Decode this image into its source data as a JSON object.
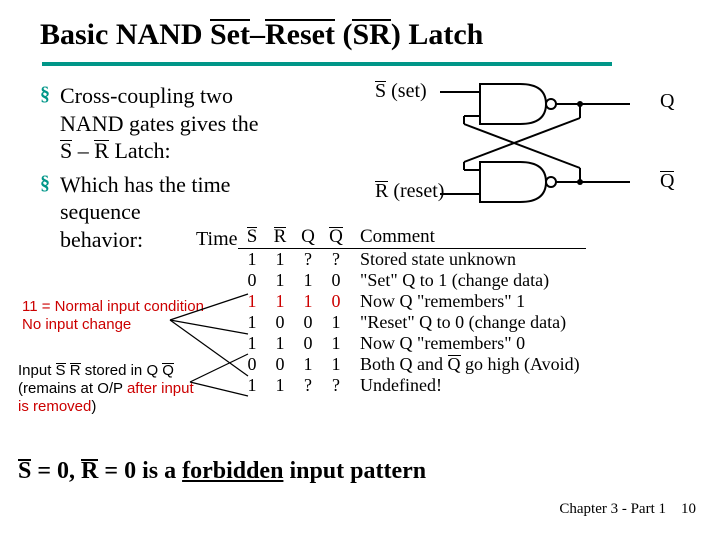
{
  "title": {
    "t1": "Basic NAND ",
    "set": "Set",
    "dash": "–",
    "reset": "Reset",
    "paren1": " (",
    "S": "S",
    "R": "R",
    "paren2": ") Latch"
  },
  "bullets": {
    "b1a": "Cross-coupling two",
    "b1b": "NAND gates gives the",
    "b1c_S": "S",
    "b1c_mid": " – ",
    "b1c_R": "R",
    "b1c_end": " Latch:",
    "b2a": "Which has the time",
    "b2b": "sequence",
    "b2c": "behavior:"
  },
  "time_label": "Time",
  "diagram": {
    "s": "S",
    "s_paren": " (set)",
    "r": "R",
    "r_paren": " (reset)",
    "Q": "Q",
    "Qb": "Q"
  },
  "note1": {
    "l1": "11 = Normal input condition",
    "l2": "No input change"
  },
  "note2": {
    "l1a": "Input ",
    "S": "S",
    "sp": " ",
    "R": "R",
    "l1b": " stored in ",
    "Q": "Q",
    "Qb": "Q",
    "l2": "(remains at O/P ",
    "l2r": "after input",
    "l3": "is removed",
    "l3b": ")"
  },
  "headers": {
    "S": "S",
    "R": "R",
    "Q": "Q",
    "Qb": "Q",
    "C": "Comment"
  },
  "rows": [
    {
      "s": "1",
      "r": "1",
      "q": "?",
      "qb": "?",
      "c": "Stored state unknown"
    },
    {
      "s": "0",
      "r": "1",
      "q": "1",
      "qb": "0",
      "c": "\"Set\" Q to 1 (change data)"
    },
    {
      "s": "1",
      "r": "1",
      "q": "1",
      "qb": "0",
      "c": "Now Q \"remembers\" 1",
      "red": true
    },
    {
      "s": "1",
      "r": "0",
      "q": "0",
      "qb": "1",
      "c": "\"Reset\" Q to 0 (change data)"
    },
    {
      "s": "1",
      "r": "1",
      "q": "0",
      "qb": "1",
      "c": "Now Q \"remembers\" 0"
    },
    {
      "s": "0",
      "r": "0",
      "q": "1",
      "qb": "1",
      "c_pre": "Both Q and ",
      "c_qb": "Q",
      "c_post": " go high (Avoid)"
    },
    {
      "s": "1",
      "r": "1",
      "q": "?",
      "qb": "?",
      "c": "Undefined!"
    }
  ],
  "bottom": {
    "S": "S",
    "mid1": " = 0, ",
    "R": "R",
    "mid2": " = 0 is a ",
    "forb": "forbidden",
    "end": " input pattern"
  },
  "footer": {
    "chap": "Chapter 3 - Part 1",
    "page": "10"
  }
}
